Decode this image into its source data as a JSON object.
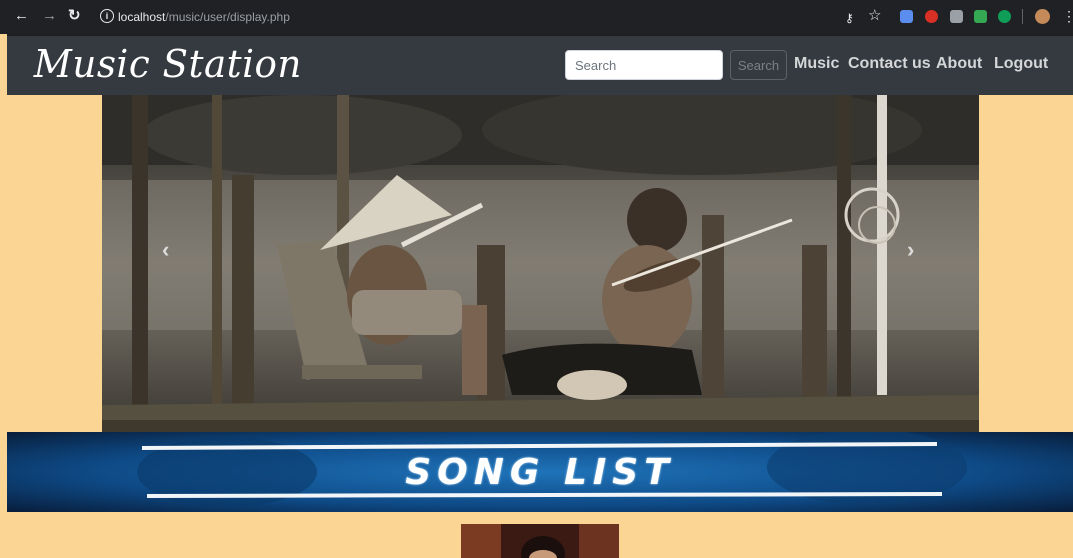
{
  "browser": {
    "url_host": "localhost",
    "url_path": "/music/user/display.php"
  },
  "navbar": {
    "brand": "Music Station",
    "search_placeholder": "Search",
    "search_button": "Search",
    "links": [
      "Music",
      "Contact us",
      "About",
      "Logout"
    ]
  },
  "banner": {
    "title": "SONG LIST"
  },
  "colors": {
    "page_bg": "#fbd593",
    "navbar_bg": "#343a40",
    "banner_blue": "#0d4f8a"
  }
}
